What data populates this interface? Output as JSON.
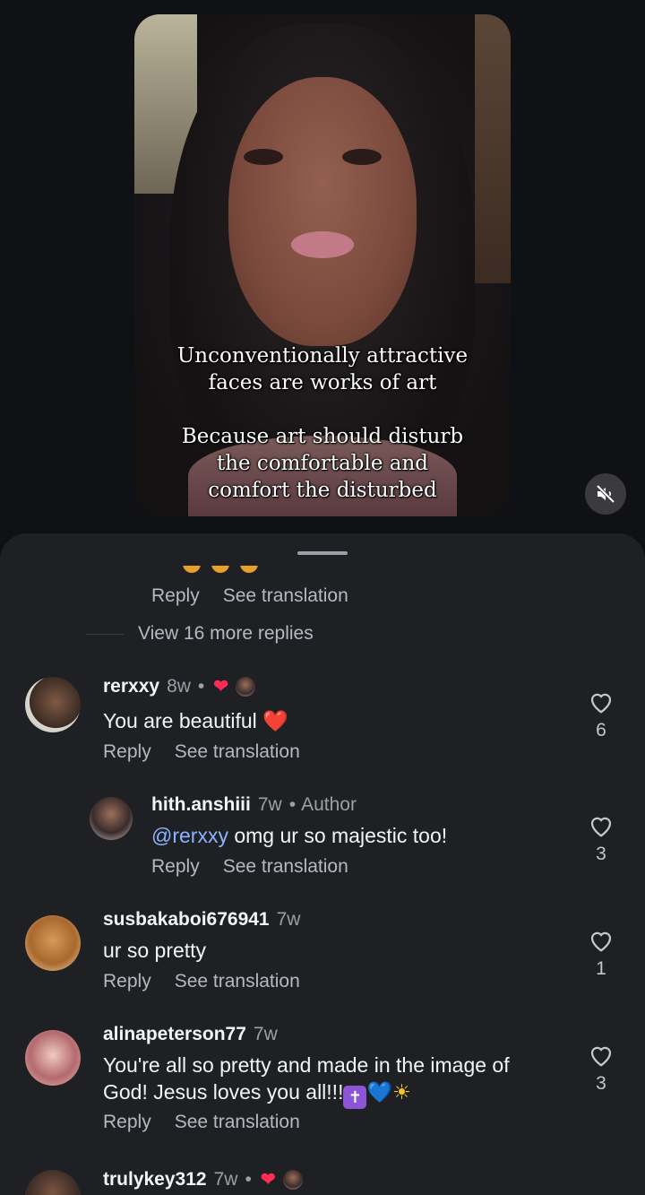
{
  "video": {
    "caption_line1": "Unconventionally attractive",
    "caption_line2": "faces are works of art",
    "caption_line3": "Because art should disturb",
    "caption_line4": "the comfortable and",
    "caption_line5": "comfort the disturbed",
    "mute_icon": "speaker-muted-icon"
  },
  "comments_sheet": {
    "top_actions": {
      "reply": "Reply",
      "translate": "See translation"
    },
    "view_more_replies": "View 16 more replies",
    "comments": [
      {
        "username": "rerxxy",
        "time": "8w",
        "separator": "•",
        "liked_by_author_icon": "red-heart-icon",
        "text": "You are beautiful",
        "emoji": "❤️",
        "reply": "Reply",
        "translate": "See translation",
        "likes": "6"
      },
      {
        "username": "hith.anshiii",
        "time": "7w",
        "separator": "•",
        "badge": "Author",
        "mention": "@rerxxy",
        "text": " omg ur so majestic too!",
        "reply": "Reply",
        "translate": "See translation",
        "likes": "3"
      },
      {
        "username": "susbakaboi676941",
        "time": "7w",
        "text": "ur so pretty",
        "reply": "Reply",
        "translate": "See translation",
        "likes": "1"
      },
      {
        "username": "alinapeterson77",
        "time": "7w",
        "text_line1": "You're all so pretty and made in the image of",
        "text_line2": "God! Jesus loves you all!!!",
        "emoji_cross": "✝",
        "emoji_heart": "💙",
        "emoji_sun": "☀",
        "reply": "Reply",
        "translate": "See translation",
        "likes": "3"
      },
      {
        "username": "trulykey312",
        "time": "7w",
        "separator": "•"
      }
    ],
    "accent_color": "#8ab4ff",
    "like_heart_color": "#ff2d55"
  }
}
